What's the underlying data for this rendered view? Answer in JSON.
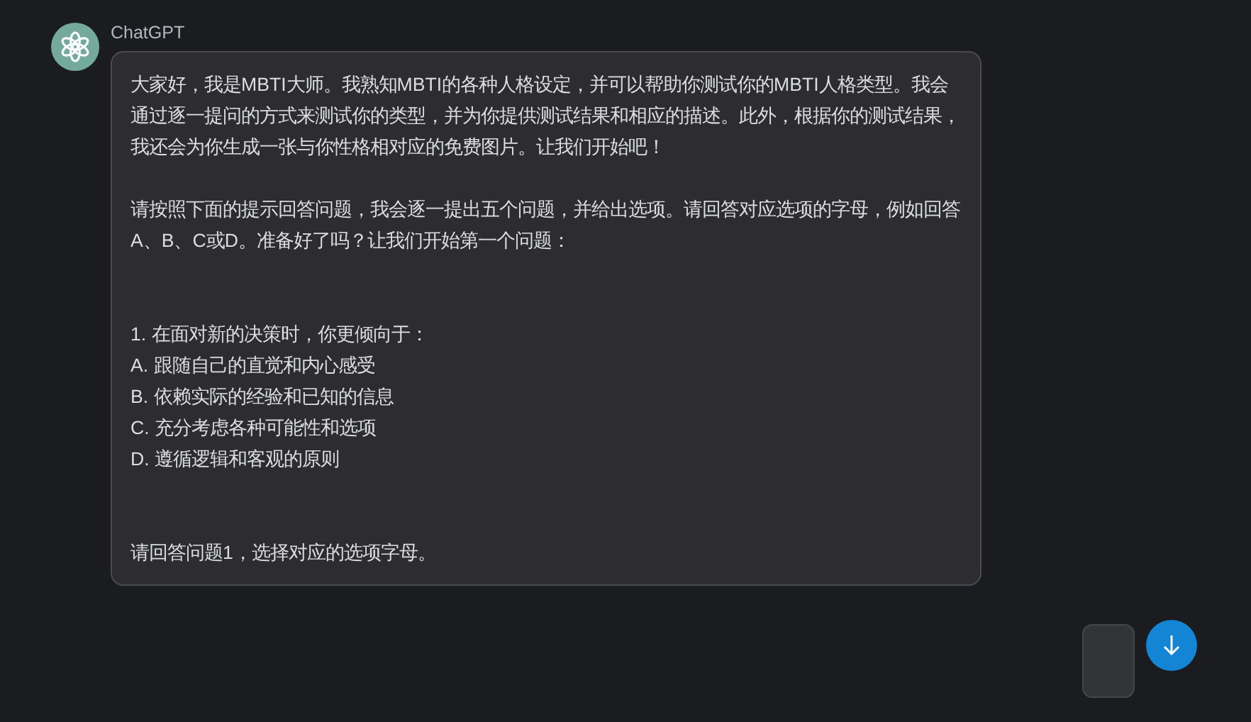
{
  "sender": {
    "name": "ChatGPT"
  },
  "message": {
    "paragraphs": [
      "大家好，我是MBTI大师。我熟知MBTI的各种人格设定，并可以帮助你测试你的MBTI人格类型。我会通过逐一提问的方式来测试你的类型，并为你提供测试结果和相应的描述。此外，根据你的测试结果，我还会为你生成一张与你性格相对应的免费图片。让我们开始吧！",
      "请按照下面的提示回答问题，我会逐一提出五个问题，并给出选项。请回答对应选项的字母，例如回答A、B、C或D。准备好了吗？让我们开始第一个问题："
    ],
    "question": {
      "title": "1. 在面对新的决策时，你更倾向于：",
      "options": [
        "A. 跟随自己的直觉和内心感受",
        "B. 依赖实际的经验和已知的信息",
        "C. 充分考虑各种可能性和选项",
        "D. 遵循逻辑和客观的原则"
      ]
    },
    "closing": "请回答问题1，选择对应的选项字母。"
  }
}
